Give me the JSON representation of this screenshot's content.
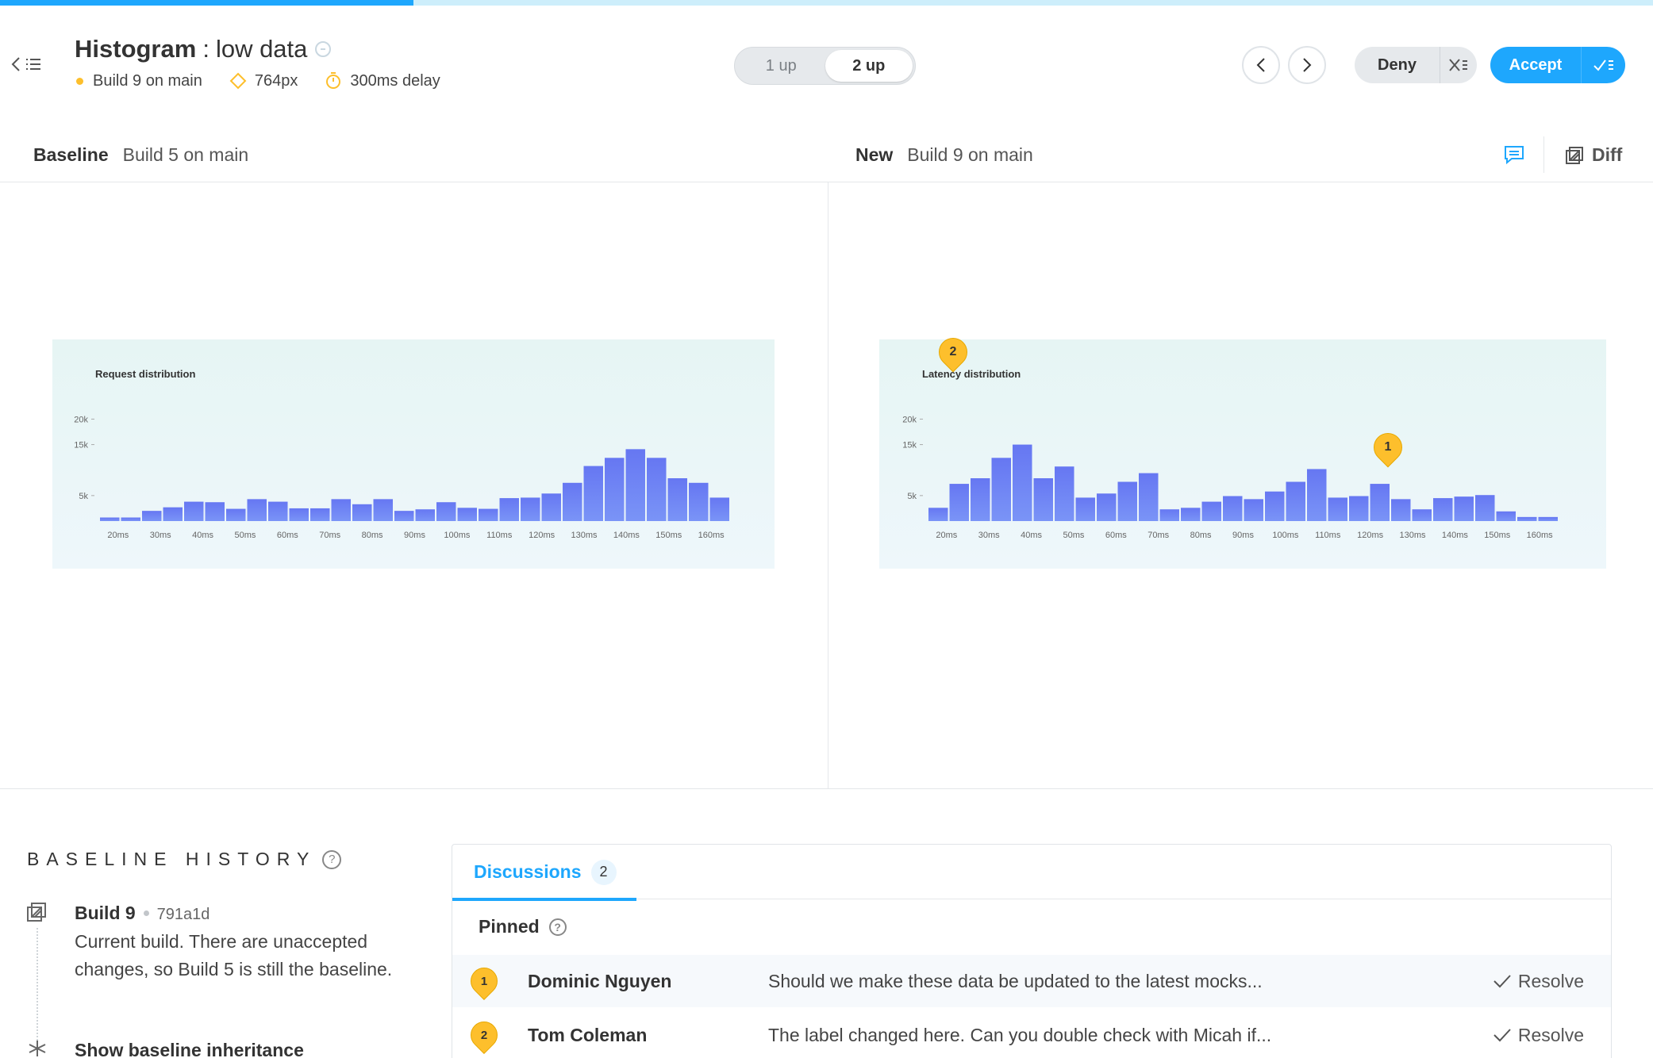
{
  "progress": {
    "fraction": 0.25
  },
  "header": {
    "back_icon": "chevron-left-icon",
    "list_icon": "list-icon",
    "component_name": "Histogram",
    "separator": ":",
    "story_name": "low data",
    "link_icon": "arrow-circle-icon",
    "meta": {
      "build": "Build 9 on main",
      "viewport": "764px",
      "delay": "300ms delay"
    },
    "view_toggle": {
      "options": [
        "1 up",
        "2 up"
      ],
      "selected": "2 up"
    },
    "deny_label": "Deny",
    "accept_label": "Accept"
  },
  "panes": {
    "baseline": {
      "label": "Baseline",
      "build": "Build 5 on main"
    },
    "new": {
      "label": "New",
      "build": "Build 9 on main"
    },
    "diff_label": "Diff"
  },
  "colors": {
    "accent": "#1ea7fd",
    "bar": "#7a94f7",
    "bar_top": "#6677f2",
    "pin": "#fdbf2c"
  },
  "chart_data": [
    {
      "type": "bar",
      "title": "Request distribution",
      "ylim": [
        0,
        28000
      ],
      "yticks": [
        {
          "value": 5000,
          "label": "5k"
        },
        {
          "value": 15000,
          "label": "15k"
        },
        {
          "value": 20000,
          "label": "20k"
        }
      ],
      "xtick_labels": [
        "20ms",
        "30ms",
        "40ms",
        "50ms",
        "60ms",
        "70ms",
        "80ms",
        "90ms",
        "100ms",
        "110ms",
        "120ms",
        "130ms",
        "140ms",
        "150ms",
        "160ms"
      ],
      "values": [
        700,
        700,
        2000,
        2700,
        3800,
        3700,
        2400,
        4300,
        3800,
        2500,
        2500,
        4300,
        3300,
        4300,
        2000,
        2300,
        3700,
        2600,
        2400,
        4500,
        4600,
        5400,
        7500,
        10800,
        12400,
        14100,
        12400,
        8400,
        7500,
        4600
      ]
    },
    {
      "type": "bar",
      "title": "Latency distribution",
      "ylim": [
        0,
        28000
      ],
      "yticks": [
        {
          "value": 5000,
          "label": "5k"
        },
        {
          "value": 15000,
          "label": "15k"
        },
        {
          "value": 20000,
          "label": "20k"
        }
      ],
      "xtick_labels": [
        "20ms",
        "30ms",
        "40ms",
        "50ms",
        "60ms",
        "70ms",
        "80ms",
        "90ms",
        "100ms",
        "110ms",
        "120ms",
        "130ms",
        "140ms",
        "150ms",
        "160ms"
      ],
      "values": [
        2600,
        7300,
        8400,
        12400,
        15000,
        8400,
        10700,
        4600,
        5400,
        7700,
        9400,
        2300,
        2600,
        3800,
        4900,
        4300,
        5800,
        7700,
        10200,
        4600,
        4900,
        7300,
        4300,
        2300,
        4500,
        4800,
        5100,
        1900,
        800,
        800
      ]
    }
  ],
  "pins": [
    {
      "number": "2",
      "chart": 1
    },
    {
      "number": "1",
      "chart": 1
    }
  ],
  "baseline_history": {
    "title": "BASELINE HISTORY",
    "entry": {
      "build": "Build 9",
      "commit": "791a1d",
      "description": "Current build. There are unaccepted changes, so Build 5 is still the baseline."
    },
    "show_inheritance": "Show baseline inheritance"
  },
  "discussions": {
    "tab_label": "Discussions",
    "count": "2",
    "pinned_label": "Pinned",
    "items": [
      {
        "pin": "1",
        "author": "Dominic Nguyen",
        "text": "Should we make these data be updated to the latest mocks...",
        "action": "Resolve"
      },
      {
        "pin": "2",
        "author": "Tom Coleman",
        "text": "The label changed here. Can you double check with Micah if...",
        "action": "Resolve"
      }
    ]
  }
}
